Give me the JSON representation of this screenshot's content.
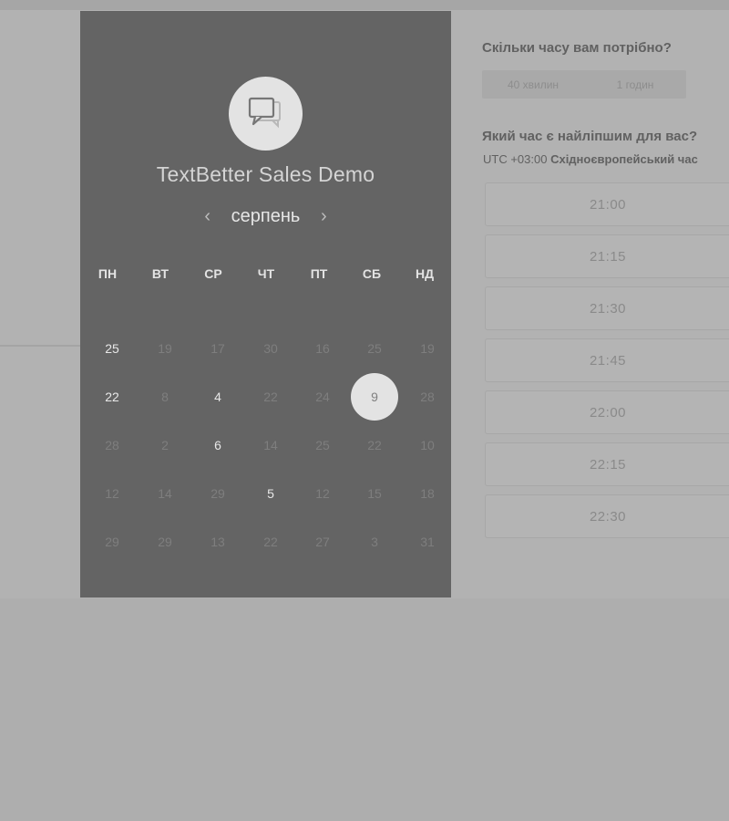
{
  "calendar": {
    "title": "TextBetter Sales Demo",
    "icon": "chat-bubbles-icon",
    "month": "серпень",
    "prev_label": "‹",
    "next_label": "›",
    "weekdays": [
      "ПН",
      "ВТ",
      "СР",
      "ЧТ",
      "ПТ",
      "СБ",
      "НД"
    ],
    "weeks": [
      [
        {
          "d": "25",
          "s": "available"
        },
        {
          "d": "19",
          "s": "off"
        },
        {
          "d": "17",
          "s": "off"
        },
        {
          "d": "30",
          "s": "off"
        },
        {
          "d": "16",
          "s": "off"
        },
        {
          "d": "25",
          "s": "off"
        },
        {
          "d": "19",
          "s": "off"
        }
      ],
      [
        {
          "d": "22",
          "s": "available"
        },
        {
          "d": "8",
          "s": "off"
        },
        {
          "d": "4",
          "s": "available"
        },
        {
          "d": "22",
          "s": "off"
        },
        {
          "d": "24",
          "s": "off"
        },
        {
          "d": "9",
          "s": "selected"
        },
        {
          "d": "28",
          "s": "off"
        }
      ],
      [
        {
          "d": "28",
          "s": "off"
        },
        {
          "d": "2",
          "s": "off"
        },
        {
          "d": "6",
          "s": "available"
        },
        {
          "d": "14",
          "s": "off"
        },
        {
          "d": "25",
          "s": "off"
        },
        {
          "d": "22",
          "s": "off"
        },
        {
          "d": "10",
          "s": "off"
        }
      ],
      [
        {
          "d": "12",
          "s": "off"
        },
        {
          "d": "14",
          "s": "off"
        },
        {
          "d": "29",
          "s": "off"
        },
        {
          "d": "5",
          "s": "available"
        },
        {
          "d": "12",
          "s": "off"
        },
        {
          "d": "15",
          "s": "off"
        },
        {
          "d": "18",
          "s": "off"
        }
      ],
      [
        {
          "d": "29",
          "s": "off"
        },
        {
          "d": "29",
          "s": "off"
        },
        {
          "d": "13",
          "s": "off"
        },
        {
          "d": "22",
          "s": "off"
        },
        {
          "d": "27",
          "s": "off"
        },
        {
          "d": "3",
          "s": "off"
        },
        {
          "d": "31",
          "s": "off"
        }
      ]
    ]
  },
  "duration": {
    "question": "Скільки часу вам потрібно?",
    "options": [
      "40 хвилин",
      "1 годин"
    ]
  },
  "time": {
    "question": "Який час є найліпшим для вас?",
    "tz_offset": "UTC +03:00",
    "tz_name": "Східноєвропейський час",
    "slots": [
      "21:00",
      "21:15",
      "21:30",
      "21:45",
      "22:00",
      "22:15",
      "22:30"
    ]
  }
}
